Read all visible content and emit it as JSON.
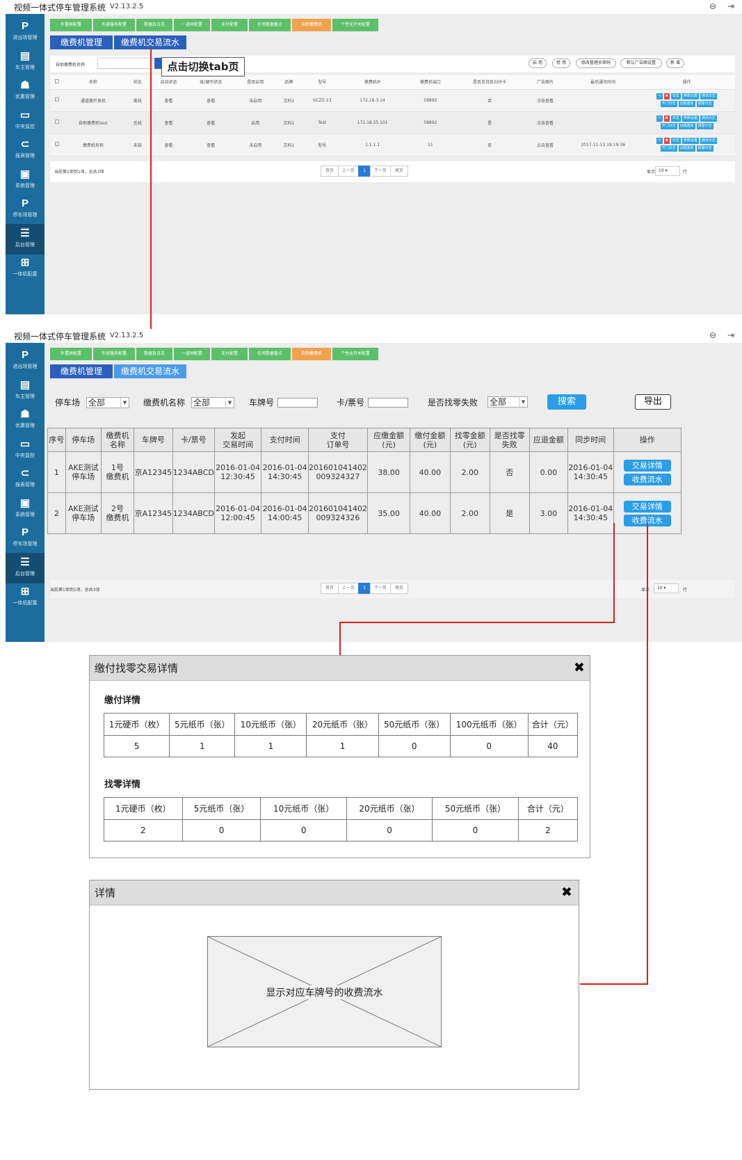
{
  "app": {
    "title": "视频一体式停车管理系统",
    "version": "V2.13.2.5"
  },
  "sidebar": [
    {
      "label": "进出场管理",
      "icon": "parking-p-icon",
      "glyph": "P"
    },
    {
      "label": "车主管理",
      "icon": "user-card-icon",
      "glyph": "▤"
    },
    {
      "label": "优惠管理",
      "icon": "ticket-icon",
      "glyph": "☗"
    },
    {
      "label": "中央监控",
      "icon": "monitor-icon",
      "glyph": "▭"
    },
    {
      "label": "报表管理",
      "icon": "paperclip-icon",
      "glyph": "⊂"
    },
    {
      "label": "系统管理",
      "icon": "screen-settings-icon",
      "glyph": "▣"
    },
    {
      "label": "停车场管理",
      "icon": "parking-lot-icon",
      "glyph": "P"
    },
    {
      "label": "后台管理",
      "icon": "list-icon",
      "glyph": "☰"
    },
    {
      "label": "一体机配置",
      "icon": "network-icon",
      "glyph": "⊞"
    }
  ],
  "nav_tabs": [
    "外置屏配置",
    "外部服务配置",
    "数据及日志",
    "一道闸配置",
    "支付配置",
    "在场数据盘点",
    "自助缴费机",
    "个性化开关配置"
  ],
  "sub_tabs": [
    "缴费机管理",
    "缴费机交易流水"
  ],
  "screen1": {
    "filter_label": "自助缴费机名称",
    "toolbar_buttons": [
      "启 用",
      "禁 用",
      "修改管理员密码",
      "默认广告图设置",
      "新 增"
    ],
    "columns": [
      "名称",
      "状态",
      "自动状态",
      "纸/硬币状态",
      "是否启用",
      "品牌",
      "型号",
      "缴费机IP",
      "缴费机端口",
      "是否支持反向付卡",
      "广告图片",
      "最后通讯时间",
      "操作"
    ],
    "rows": [
      [
        "通道缴开发机",
        "离线",
        "查看",
        "查看",
        "未启用",
        "艾科1",
        "GCZZ-13",
        "172.18.3.14",
        "58892",
        "否",
        "点击查看",
        ""
      ],
      [
        "自助缴费机test",
        "在线",
        "查看",
        "查看",
        "启用",
        "艾科1",
        "Test",
        "172.18.55.101",
        "58892",
        "是",
        "点击查看",
        ""
      ],
      [
        "缴费机名称",
        "未知",
        "查看",
        "查看",
        "未启用",
        "艾科1",
        "型号",
        "1.1.1.1",
        "11",
        "否",
        "点击查看",
        "2017-11-13 19:19:36"
      ]
    ],
    "op_buttons": [
      [
        "日志",
        "参数设置",
        "通讯日志"
      ],
      [
        "开门日志",
        "远程重启",
        "报警日志"
      ]
    ],
    "footer_text": "当前第1项到1项，总共3项",
    "pager": [
      "首页",
      "上一页",
      "1",
      "下一页",
      "尾页"
    ],
    "page_size_label": "显示",
    "page_size": "10",
    "page_size_unit": "行"
  },
  "callout": "点击切换tab页",
  "screen2": {
    "filters": {
      "parking_label": "停车场",
      "parking_value": "全部",
      "machine_label": "缴费机名称",
      "machine_value": "全部",
      "plate_label": "车牌号",
      "ticket_label": "卡/票号",
      "change_fail_label": "是否找零失败",
      "change_fail_value": "全部",
      "search_btn": "搜索",
      "export_btn": "导出"
    },
    "columns": [
      "序号",
      "停车场",
      "缴费机\n名称",
      "车牌号",
      "卡/票号",
      "发起\n交易时间",
      "支付时间",
      "支付\n订单号",
      "应缴金额\n(元)",
      "缴付金额\n(元)",
      "找零金额\n(元)",
      "是否找零\n失败",
      "应退金额",
      "同步时间",
      "操作"
    ],
    "rows": [
      [
        "1",
        "AKE测试\n停车场",
        "1号\n缴费机",
        "京A12345",
        "1234ABCD",
        "2016-01-04\n12:30:45",
        "2016-01-04\n14:30:45",
        "201601041402\n009324327",
        "38.00",
        "40.00",
        "2.00",
        "否",
        "0.00",
        "2016-01-04\n14:30:45"
      ],
      [
        "2",
        "AKE测试\n停车场",
        "2号\n缴费机",
        "京A12345",
        "1234ABCD",
        "2016-01-04\n12:00:45",
        "2016-01-04\n14:00:45",
        "201601041402\n009324326",
        "35.00",
        "40.00",
        "2.00",
        "是",
        "3.00",
        "2016-01-04\n14:30:45"
      ]
    ],
    "action_buttons": [
      "交易详情",
      "收费流水"
    ],
    "footer_text": "当前第1项到1项，总共3项",
    "pager": [
      "首页",
      "上一页",
      "1",
      "下一页",
      "尾页"
    ],
    "page_size_label": "显示",
    "page_size": "10",
    "page_size_unit": "行"
  },
  "dialog1": {
    "title": "缴付找零交易详情",
    "pay_section": "缴付详情",
    "pay_headers": [
      "1元硬币（枚）",
      "5元纸币（张）",
      "10元纸币（张）",
      "20元纸币（张）",
      "50元纸币（张）",
      "100元纸币（张）",
      "合计（元）"
    ],
    "pay_values": [
      "5",
      "1",
      "1",
      "1",
      "0",
      "0",
      "40"
    ],
    "change_section": "找零详情",
    "change_headers": [
      "1元硬币（枚）",
      "5元纸币（张）",
      "10元纸币（张）",
      "20元纸币（张）",
      "50元纸币（张）",
      "合计（元）"
    ],
    "change_values": [
      "2",
      "0",
      "0",
      "0",
      "0",
      "2"
    ]
  },
  "dialog2": {
    "title": "详情",
    "placeholder_text": "显示对应车牌号的收费流水"
  },
  "colors": {
    "sidebar": "#1c6d9e",
    "nav_tab": "#5cbf6a",
    "nav_tab_active": "#f0a24f",
    "sub_tab": "#4c9be8",
    "sub_tab_active": "#2a5fbc",
    "connector": "#d81e1e",
    "button": "#2a9de8"
  }
}
